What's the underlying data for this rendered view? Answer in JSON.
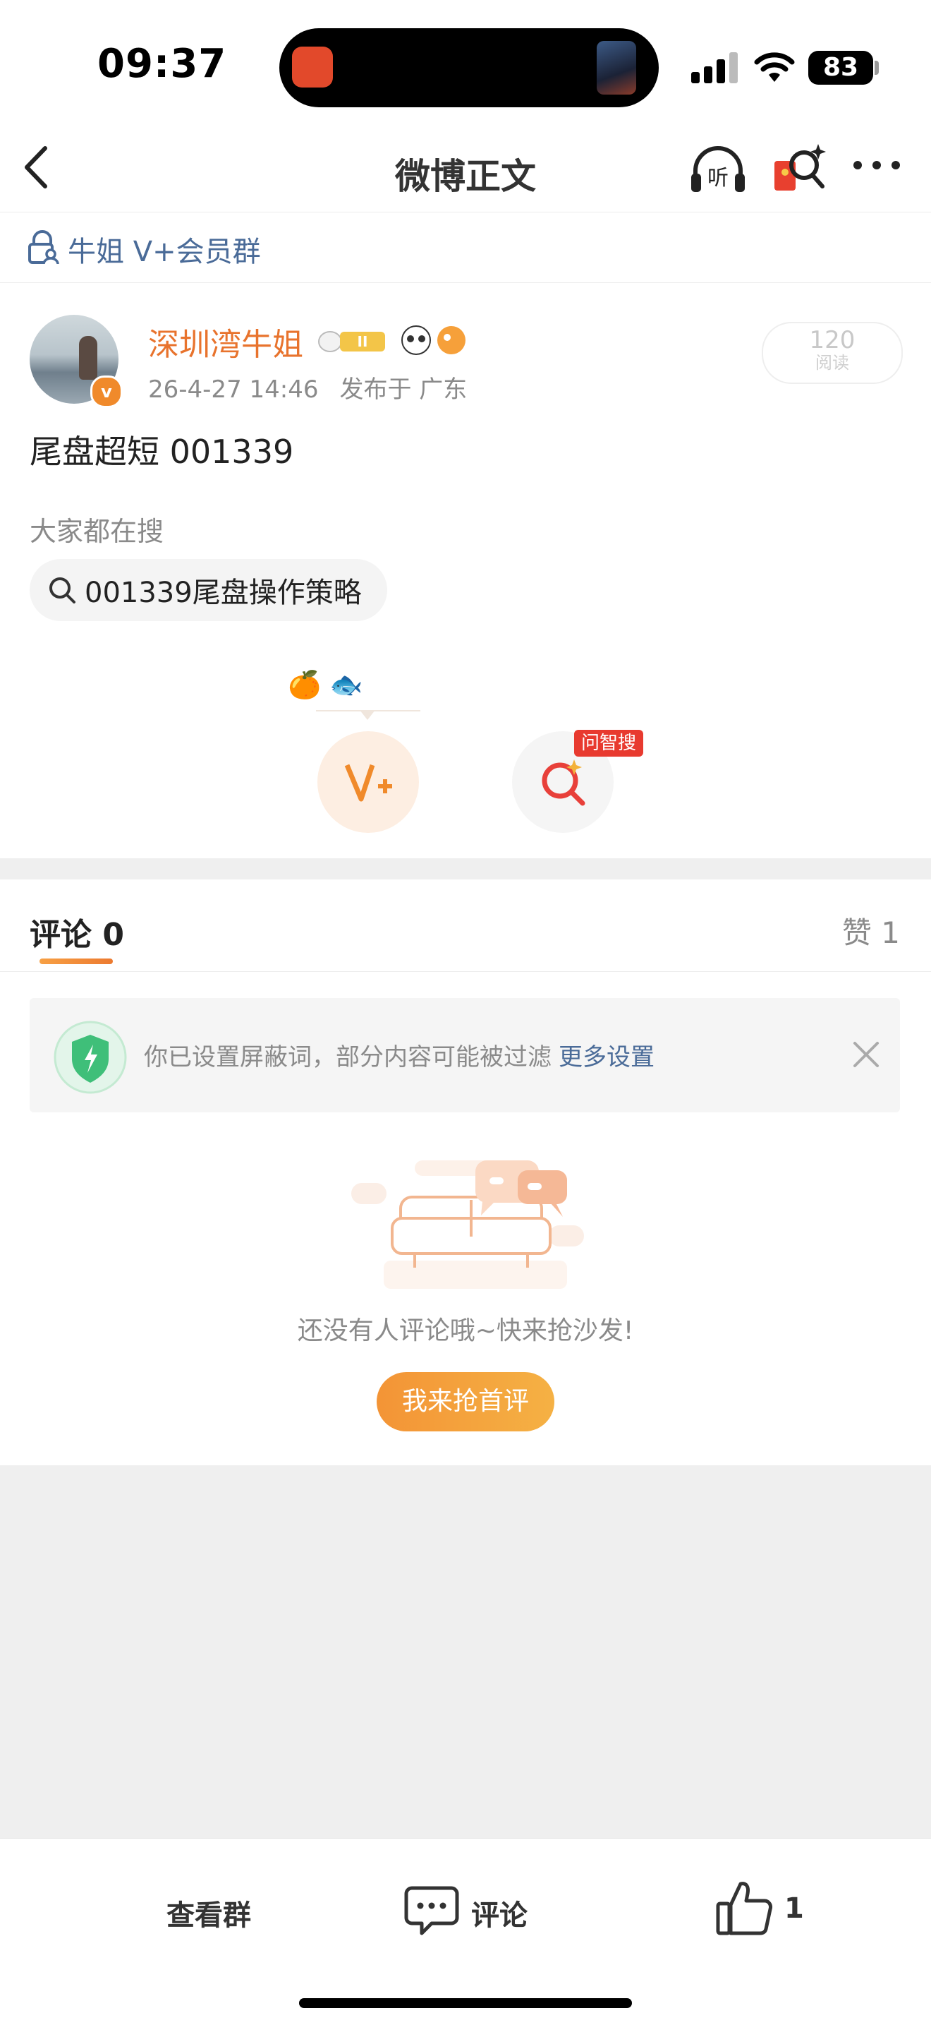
{
  "status_bar": {
    "time": "09:37",
    "battery": "83"
  },
  "nav": {
    "title": "微博正文"
  },
  "group": {
    "label": "牛姐 V+会员群"
  },
  "post": {
    "author": "深圳湾牛姐",
    "date": "26-4-27 14:46",
    "location": "发布于 广东",
    "reads_count": "120",
    "reads_label": "阅读",
    "text": "尾盘超短 001339",
    "search_header": "大家都在搜",
    "search_chip": "001339尾盘操作策略",
    "emoji": "🍊 🐟",
    "ask_badge": "问智搜"
  },
  "comments": {
    "tab_label": "评论 0",
    "likes_label": "赞 1",
    "filter_notice": "你已设置屏蔽词，部分内容可能被过滤",
    "filter_link": "更多设置",
    "empty_text": "还没有人评论哦~快来抢沙发!",
    "first_comment_button": "我来抢首评"
  },
  "bottom_bar": {
    "view_group": "查看群",
    "comment": "评论",
    "like_count": "1"
  },
  "colors": {
    "accent_orange": "#e8732d",
    "link_blue": "#4a6b98",
    "badge_red": "#e83a2f"
  }
}
